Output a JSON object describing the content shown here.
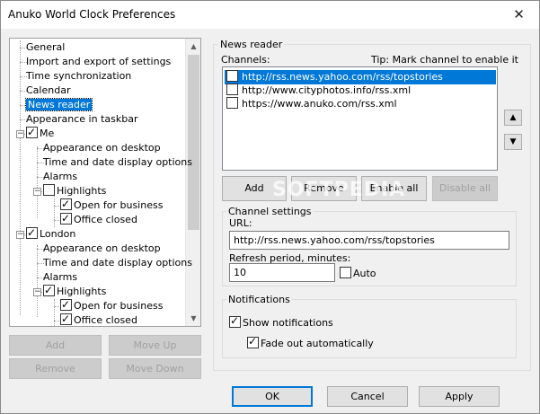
{
  "window": {
    "title": "Anuko World Clock Preferences",
    "close_glyph": "✕"
  },
  "tree": {
    "items": [
      {
        "label": "General",
        "indent": 0,
        "checkbox": null
      },
      {
        "label": "Import and export of settings",
        "indent": 0,
        "checkbox": null
      },
      {
        "label": "Time synchronization",
        "indent": 0,
        "checkbox": null
      },
      {
        "label": "Calendar",
        "indent": 0,
        "checkbox": null
      },
      {
        "label": "News reader",
        "indent": 0,
        "checkbox": null,
        "selected": true
      },
      {
        "label": "Appearance in taskbar",
        "indent": 0,
        "checkbox": null
      },
      {
        "label": "Me",
        "indent": 0,
        "checkbox": true,
        "expander": "−"
      },
      {
        "label": "Appearance on desktop",
        "indent": 1,
        "checkbox": null
      },
      {
        "label": "Time and date display options",
        "indent": 1,
        "checkbox": null
      },
      {
        "label": "Alarms",
        "indent": 1,
        "checkbox": null
      },
      {
        "label": "Highlights",
        "indent": 1,
        "checkbox": false,
        "expander": "−"
      },
      {
        "label": "Open for business",
        "indent": 2,
        "checkbox": true
      },
      {
        "label": "Office closed",
        "indent": 2,
        "checkbox": true
      },
      {
        "label": "London",
        "indent": 0,
        "checkbox": true,
        "expander": "−"
      },
      {
        "label": "Appearance on desktop",
        "indent": 1,
        "checkbox": null
      },
      {
        "label": "Time and date display options",
        "indent": 1,
        "checkbox": null
      },
      {
        "label": "Alarms",
        "indent": 1,
        "checkbox": null
      },
      {
        "label": "Highlights",
        "indent": 1,
        "checkbox": true,
        "expander": "−"
      },
      {
        "label": "Open for business",
        "indent": 2,
        "checkbox": true
      },
      {
        "label": "Office closed",
        "indent": 2,
        "checkbox": true
      }
    ]
  },
  "left_buttons": {
    "add": "Add",
    "move_up": "Move Up",
    "remove": "Remove",
    "move_down": "Move Down"
  },
  "news_reader": {
    "group_title": "News reader",
    "channels_label": "Channels:",
    "tip": "Tip: Mark channel to enable it",
    "channels": [
      {
        "url": "http://rss.news.yahoo.com/rss/topstories",
        "checked": false,
        "selected": true
      },
      {
        "url": "http://www.cityphotos.info/rss.xml",
        "checked": false,
        "selected": false
      },
      {
        "url": "https://www.anuko.com/rss.xml",
        "checked": false,
        "selected": false
      }
    ],
    "buttons": {
      "add": "Add",
      "remove": "Remove",
      "enable_all": "Enable all",
      "disable_all": "Disable all"
    },
    "up_glyph": "▲",
    "down_glyph": "▼"
  },
  "watermark": "SOFTPEDIA",
  "channel_settings": {
    "group_title": "Channel settings",
    "url_label": "URL:",
    "url_value": "http://rss.news.yahoo.com/rss/topstories",
    "refresh_label": "Refresh period, minutes:",
    "refresh_value": "10",
    "auto_label": "Auto",
    "auto_checked": false
  },
  "notifications": {
    "group_title": "Notifications",
    "show_label": "Show notifications",
    "show_checked": true,
    "fade_label": "Fade out automatically",
    "fade_checked": true
  },
  "footer": {
    "ok": "OK",
    "cancel": "Cancel",
    "apply": "Apply"
  },
  "colors": {
    "selection": "#0078d7",
    "dialog_bg": "#f0f0f0"
  }
}
